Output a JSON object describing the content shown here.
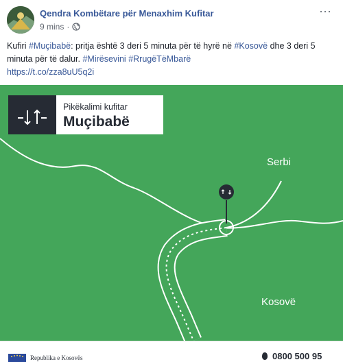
{
  "post": {
    "page_name": "Qendra Kombëtare për Menaxhim Kufitar",
    "time": "9 mins",
    "separator": "·",
    "more_icon_label": "···",
    "text": {
      "p1": "Kufiri ",
      "tag_mucibabe": "#Muçibabë",
      "p2": ": pritja është 3 deri 5 minuta për të hyrë në ",
      "tag_kosove": "#Kosovë",
      "p3": " dhe 3 deri 5 minuta për të dalur. ",
      "tag_miresevini": "#Mirësevini",
      "p4": " ",
      "tag_rruge": "#RrugëTëMbarë",
      "link": "https://t.co/zza8uU5q2i"
    }
  },
  "graphic": {
    "sign_subtitle": "Pikëkalimi kufitar",
    "sign_title": "Muçibabë",
    "label_serbia": "Serbi",
    "label_kosovo": "Kosovë",
    "background_color": "#44a65a",
    "dark_color": "#262b34"
  },
  "footer": {
    "republic_text": "Republika e Kosovës",
    "phone": "0800 500 95"
  },
  "icons": [
    "avatar",
    "globe-icon",
    "more-icon",
    "border-crossing-icon",
    "location-pin-icon",
    "emblem-icon",
    "phone-icon"
  ]
}
